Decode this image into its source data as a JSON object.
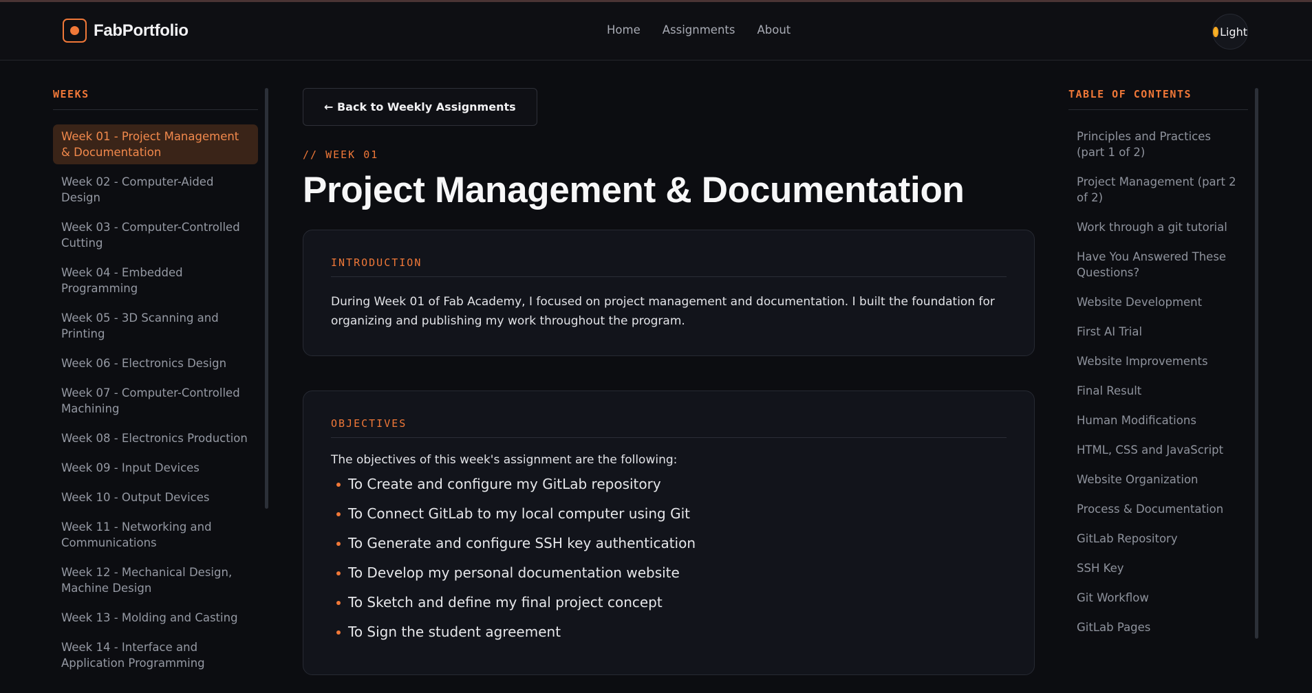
{
  "header": {
    "brand": "FabPortfolio",
    "nav": [
      "Home",
      "Assignments",
      "About"
    ],
    "theme_label": "Light"
  },
  "sidebar": {
    "heading": "WEEKS",
    "items": [
      "Week 01 - Project Management & Documentation",
      "Week 02 - Computer-Aided Design",
      "Week 03 - Computer-Controlled Cutting",
      "Week 04 - Embedded Programming",
      "Week 05 - 3D Scanning and Printing",
      "Week 06 - Electronics Design",
      "Week 07 - Computer-Controlled Machining",
      "Week 08 - Electronics Production",
      "Week 09 - Input Devices",
      "Week 10 - Output Devices",
      "Week 11 - Networking and Communications",
      "Week 12 - Mechanical Design, Machine Design",
      "Week 13 - Molding and Casting",
      "Week 14 - Interface and Application Programming"
    ],
    "active_index": 0
  },
  "main": {
    "back_label": "← Back to Weekly Assignments",
    "week_tag": "// WEEK 01",
    "title": "Project Management & Documentation",
    "intro": {
      "heading": "INTRODUCTION",
      "text": "During Week 01 of Fab Academy, I focused on project management and documentation. I built the foundation for organizing and publishing my work throughout the program."
    },
    "objectives": {
      "heading": "OBJECTIVES",
      "lead": "The objectives of this week's assignment are the following:",
      "items": [
        "To Create and configure my GitLab repository",
        "To Connect GitLab to my local computer using Git",
        "To Generate and configure SSH key authentication",
        "To Develop my personal documentation website",
        "To Sketch and define my final project concept",
        "To Sign the student agreement"
      ]
    }
  },
  "toc": {
    "heading": "TABLE OF CONTENTS",
    "items": [
      "Principles and Practices (part 1 of 2)",
      "Project Management (part 2 of 2)",
      "Work through a git tutorial",
      "Have You Answered These Questions?",
      "Website Development",
      "First AI Trial",
      "Website Improvements",
      "Final Result",
      "Human Modifications",
      "HTML, CSS and JavaScript",
      "Website Organization",
      "Process & Documentation",
      "GitLab Repository",
      "SSH Key",
      "Git Workflow",
      "GitLab Pages"
    ]
  },
  "colors": {
    "accent": "#f07838",
    "background": "#0c0d11",
    "card": "#12141b"
  }
}
